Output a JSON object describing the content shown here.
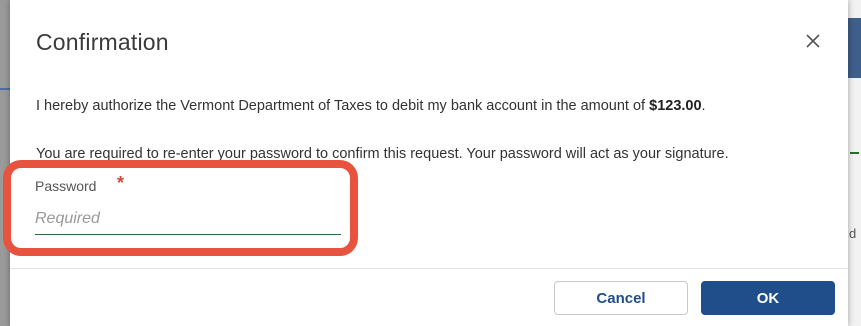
{
  "dialog": {
    "title": "Confirmation",
    "close_icon": "close-icon",
    "authorize_text": "I hereby authorize the Vermont Department of Taxes to debit my bank account in the amount of ",
    "amount": "$123.00",
    "authorize_suffix": ".",
    "reenter_text": "You are required to re-enter your password to confirm this request. Your password will act as your signature.",
    "password": {
      "label": "Password",
      "required_mark": "*",
      "placeholder": "Required",
      "value": ""
    },
    "buttons": {
      "cancel_label": "Cancel",
      "ok_label": "OK"
    }
  },
  "colors": {
    "primary": "#1f4e8a",
    "highlight": "#e8533f",
    "required": "#d24a3a",
    "field_underline": "#2f6b3a"
  }
}
